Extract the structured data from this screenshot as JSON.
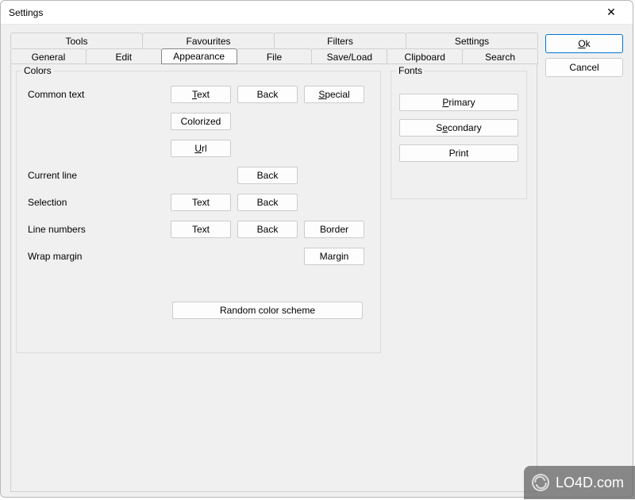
{
  "window": {
    "title": "Settings"
  },
  "buttons": {
    "ok": "Ok",
    "cancel": "Cancel"
  },
  "tabs_top": [
    "Tools",
    "Favourites",
    "Filters",
    "Settings"
  ],
  "tabs_bottom": [
    "General",
    "Edit",
    "Appearance",
    "File",
    "Save/Load",
    "Clipboard",
    "Search"
  ],
  "active_tab": "Appearance",
  "colors": {
    "legend": "Colors",
    "rows": {
      "common_text": "Common text",
      "current_line": "Current line",
      "selection": "Selection",
      "line_numbers": "Line numbers",
      "wrap_margin": "Wrap margin"
    },
    "btn": {
      "text": "Text",
      "back": "Back",
      "special": "Special",
      "colorized": "Colorized",
      "url": "Url",
      "border": "Border",
      "margin": "Margin",
      "random": "Random color scheme"
    }
  },
  "fonts": {
    "legend": "Fonts",
    "primary": "Primary",
    "secondary": "Secondary",
    "print": "Print"
  },
  "watermark": "LO4D.com"
}
